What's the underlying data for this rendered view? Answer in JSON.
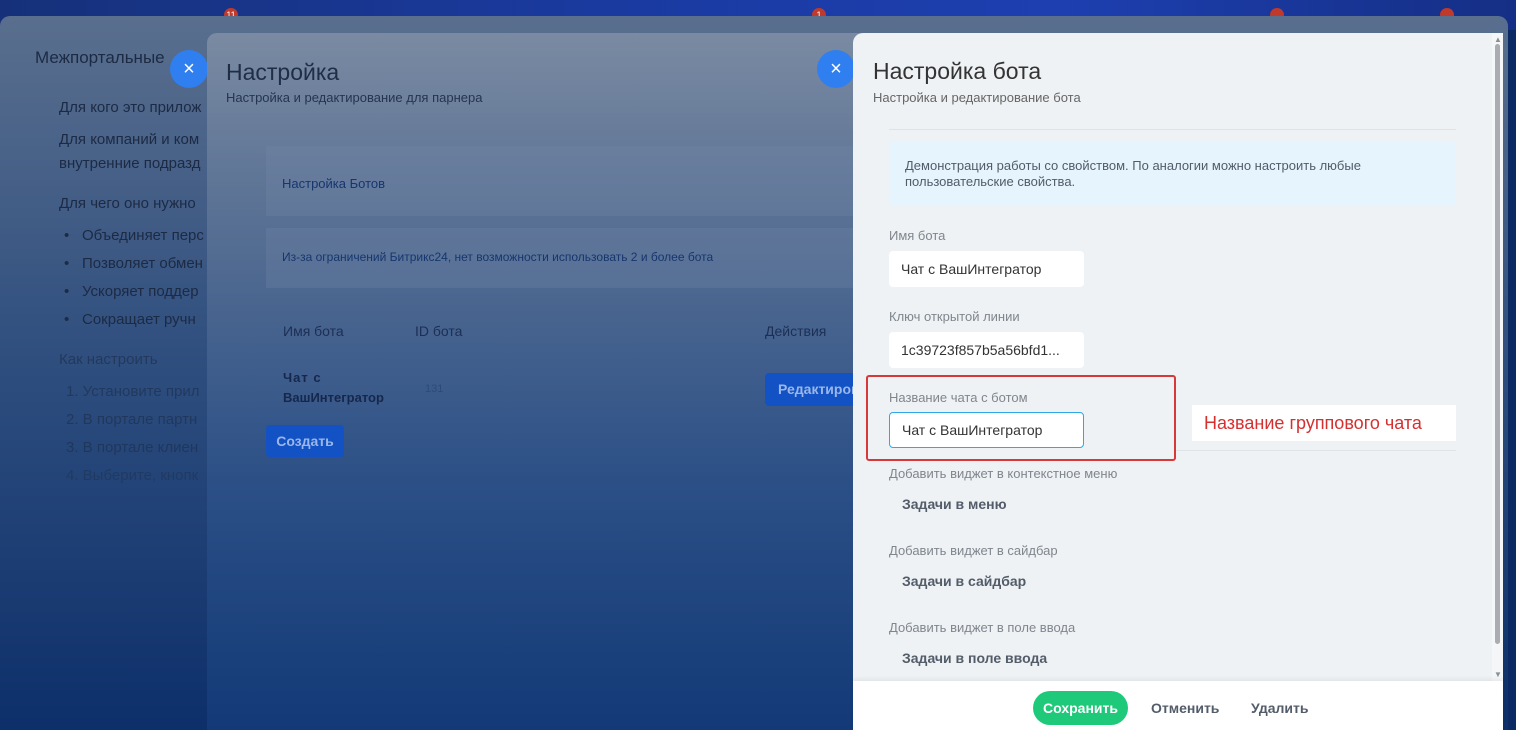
{
  "portal": {
    "badges": [
      "11",
      "1",
      "",
      ""
    ],
    "title": "Межпортальные",
    "texts": [
      "Для кого это прилож",
      "Для компаний и ком",
      "внутренние подразд",
      "Для чего оно нужно"
    ],
    "bullets": [
      "Объединяет перс",
      "Позволяет обмен",
      "Ускоряет поддер",
      "Сокращает ручн"
    ],
    "how_title": "Как настроить",
    "steps": [
      "1. Установите прил",
      "2. В портале партн",
      "3. В портале клиен",
      "4. Выберите, кнопк"
    ]
  },
  "settings_panel": {
    "close_icon": "×",
    "title": "Настройка",
    "subtitle": "Настройка и редактирование для парнера",
    "bots_link": "Настройка Ботов",
    "limit_note": "Из-за ограничений Битрикс24, нет возможности использовать 2 и более бота",
    "table": {
      "headers": [
        "Имя бота",
        "ID бота",
        "Действия"
      ],
      "rows": [
        {
          "name_line1": "Чат с",
          "name_line2": "ВашИнтегратор",
          "id": "131",
          "action": "Редактиров"
        }
      ]
    },
    "create_label": "Создать"
  },
  "bot_panel": {
    "close_icon": "×",
    "title": "Настройка бота",
    "subtitle": "Настройка и редактирование бота",
    "info": "Демонстрация работы со свойством. По аналогии можно настроить любые пользовательские свойства.",
    "fields": {
      "bot_name": {
        "label": "Имя бота",
        "value": "Чат с ВашИнтегратор"
      },
      "open_line_key": {
        "label": "Ключ открытой линии",
        "value": "1c39723f857b5a56bfd1..."
      },
      "chat_name": {
        "label": "Название чата с ботом",
        "value": "Чат с ВашИнтегратор"
      }
    },
    "widgets": [
      {
        "label": "Добавить виджет в контекстное меню",
        "value": "Задачи в меню"
      },
      {
        "label": "Добавить виджет в сайдбар",
        "value": "Задачи в сайдбар"
      },
      {
        "label": "Добавить виджет в поле ввода",
        "value": "Задачи в поле ввода"
      }
    ],
    "annotation": "Название группового чата",
    "footer": {
      "save": "Сохранить",
      "cancel": "Отменить",
      "delete": "Удалить"
    }
  },
  "colors": {
    "save": "#1ec97a",
    "annotation": "#d9383a",
    "close_button": "#2f7ff0"
  }
}
